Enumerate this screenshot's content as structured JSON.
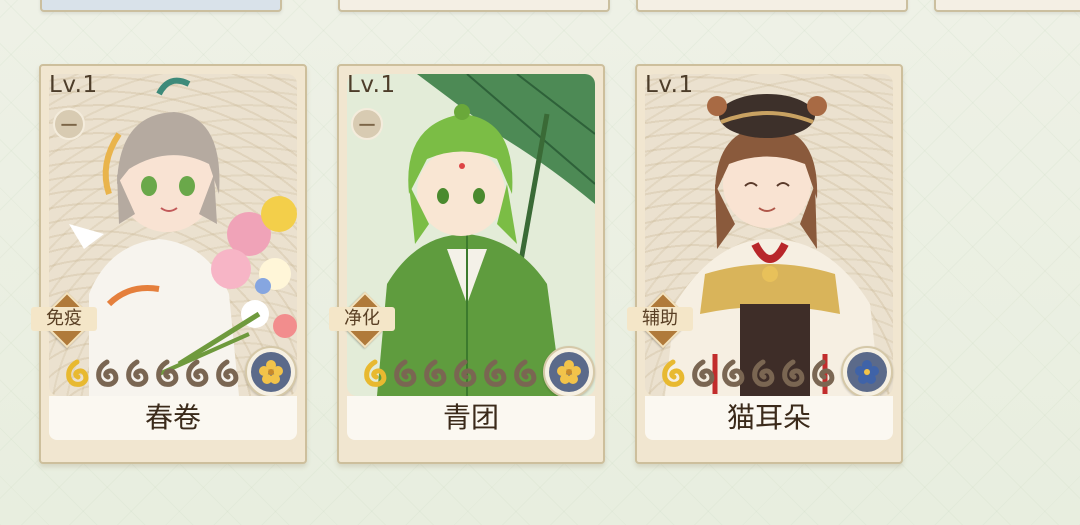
{
  "cards": [
    {
      "level": "Lv.1",
      "badge_symbol": "一",
      "tag": "免疫",
      "stars_total": 6,
      "stars_filled": 1,
      "element_color": "#f2c34a",
      "element_icon": "flower-icon",
      "name": "春卷",
      "hair_color": "#b5aaa0"
    },
    {
      "level": "Lv.1",
      "badge_symbol": "一",
      "tag": "净化",
      "stars_total": 6,
      "stars_filled": 1,
      "element_color": "#f2c34a",
      "element_icon": "flower-icon",
      "name": "青团",
      "hair_color": "#7bbd45"
    },
    {
      "level": "Lv.1",
      "badge_symbol": "",
      "tag": "辅助",
      "stars_total": 6,
      "stars_filled": 1,
      "element_color": "#3f63a8",
      "element_icon": "flower-icon",
      "name": "猫耳朵",
      "hair_color": "#8a5a3c"
    }
  ],
  "colors": {
    "star_filled": "#e8b930",
    "star_empty": "#7a6652",
    "tag_diamond": "#b07a3a"
  }
}
